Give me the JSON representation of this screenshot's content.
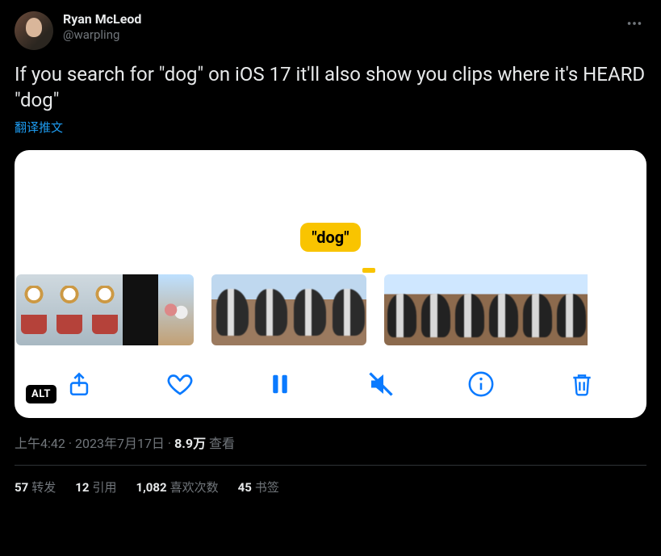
{
  "author": {
    "display_name": "Ryan McLeod",
    "handle": "@warpling"
  },
  "tweet_text": "If you search for \"dog\" on iOS 17 it'll also show you clips where it's HEARD \"dog\"",
  "translate_label": "翻译推文",
  "media": {
    "search_bubble": "\"dog\"",
    "alt_badge": "ALT",
    "toolbar_icons": [
      "share",
      "heart",
      "pause",
      "mute",
      "info",
      "trash"
    ]
  },
  "meta": {
    "time": "上午4:42",
    "date": "2023年7月17日",
    "views_count": "8.9万",
    "views_label": "查看"
  },
  "stats": {
    "retweets": {
      "count": "57",
      "label": "转发"
    },
    "quotes": {
      "count": "12",
      "label": "引用"
    },
    "likes": {
      "count": "1,082",
      "label": "喜欢次数"
    },
    "bookmarks": {
      "count": "45",
      "label": "书签"
    }
  }
}
